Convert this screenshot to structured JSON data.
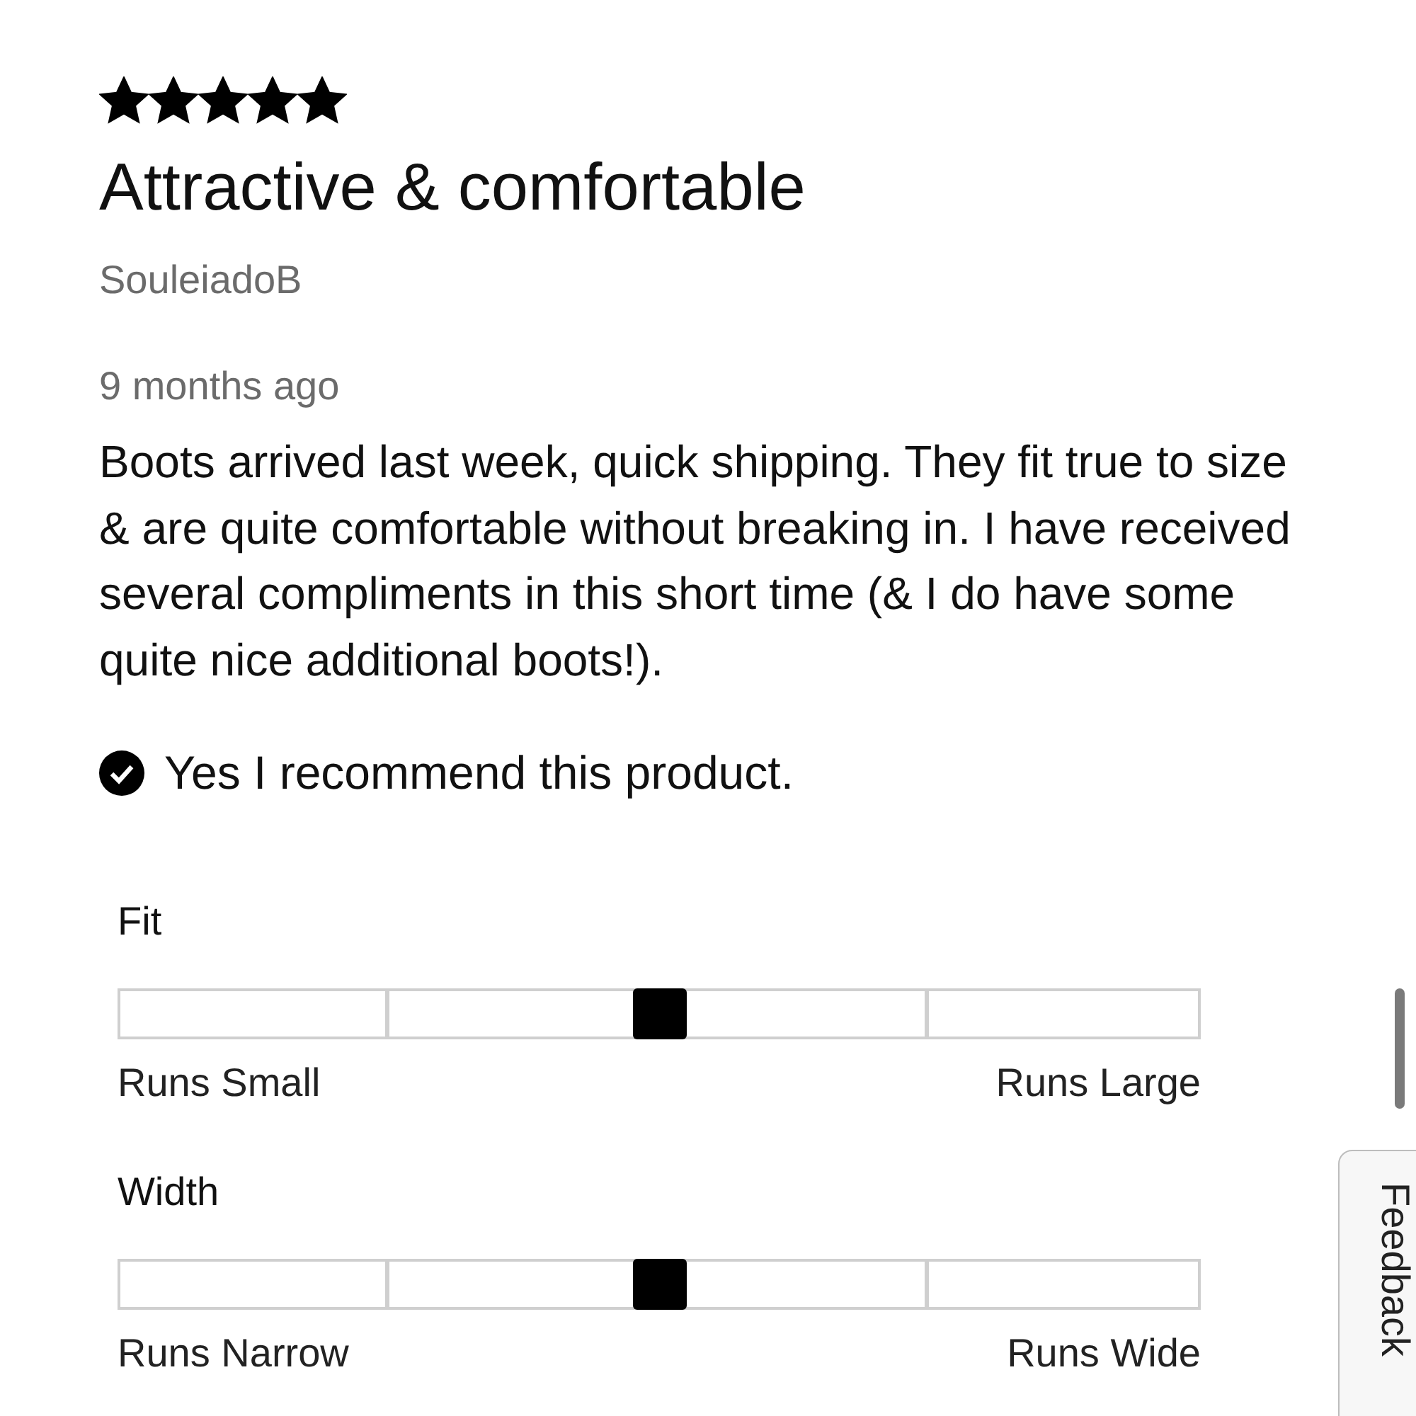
{
  "review": {
    "stars": 5,
    "title": "Attractive & comfortable",
    "author": "SouleiadoB",
    "date": "9 months ago",
    "body": "Boots arrived last week, quick shipping. They fit true to size & are quite comfortable without breaking in. I have received several compliments in this short time (& I do have some quite nice additional boots!).",
    "recommend": {
      "checked": true,
      "text": "Yes I recommend this product."
    }
  },
  "ratings": [
    {
      "label": "Fit",
      "level": 0.5,
      "low": "Runs Small",
      "high": "Runs Large"
    },
    {
      "label": "Width",
      "level": 0.5,
      "low": "Runs Narrow",
      "high": "Runs Wide"
    }
  ],
  "feedback_tab": {
    "label": "Feedback"
  }
}
